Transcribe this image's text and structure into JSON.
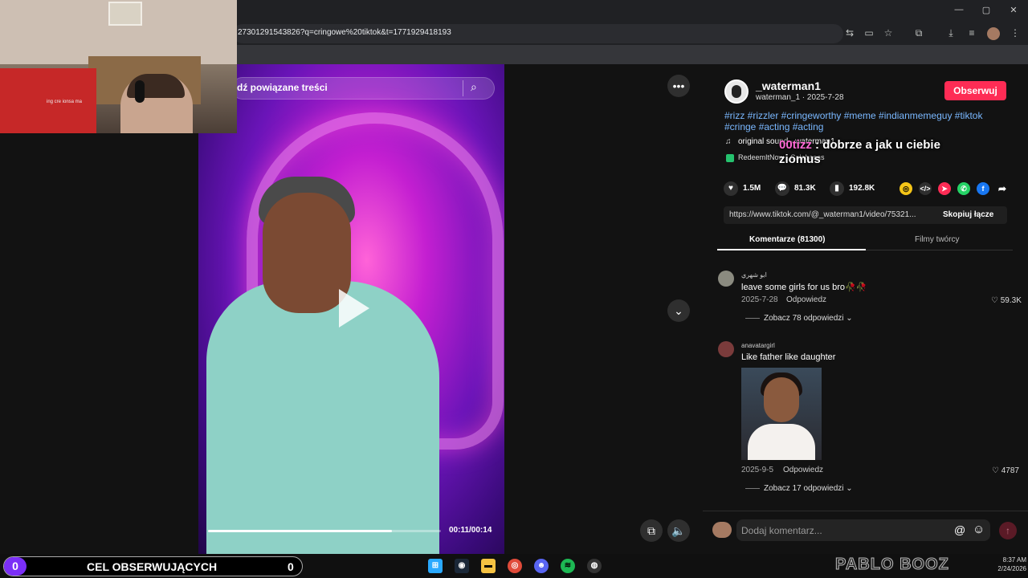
{
  "browser": {
    "url": "27301291543826?q=cringowe%20tiktok&t=1771929418193",
    "window_controls": {
      "minimize": "—",
      "maximize": "▢",
      "close": "✕"
    }
  },
  "webcam": {
    "label": "ing cre ionsa ma"
  },
  "video": {
    "search_placeholder": "dź powiązane treści",
    "time": "00:11/00:14",
    "progress": 0.79
  },
  "creator": {
    "username": "_waterman1",
    "handle_date": "waterman_1 · 2025-7-28",
    "follow_label": "Obserwuj",
    "hashtags": "#rizz #rizzler #cringeworthy #meme #indianmemeguy #tiktok #cringe #acting #acting",
    "music": "original sound - ",
    "music_tail": "waterman1",
    "redeem": "RedeemItNow · Calabasas"
  },
  "overlay": {
    "name": "00tizz",
    "message": " : dobrze a jak u ciebie",
    "message2": "ziomus"
  },
  "stats": {
    "likes": "1.5M",
    "comments": "81.3K",
    "saves": "192.8K"
  },
  "share": {
    "link": "https://www.tiktok.com/@_waterman1/video/75321...",
    "copy_label": "Skopiuj łącze"
  },
  "tabs": {
    "comments": "Komentarze (81300)",
    "creator_videos": "Filmy twórcy"
  },
  "comments": [
    {
      "user": "ابو شهري",
      "text": "leave some girls for us bro🥀🥀",
      "date": "2025-7-28",
      "reply": "Odpowiedz",
      "likes": "59.3K",
      "more": "Zobacz 78 odpowiedzi"
    },
    {
      "user": "anavatargirl",
      "text": "Like father like daughter",
      "date": "2025-9-5",
      "reply": "Odpowiedz",
      "likes": "4787",
      "more": "Zobacz 17 odpowiedzi"
    }
  ],
  "comment_input": {
    "placeholder": "Dodaj komentarz..."
  },
  "stream_goal": {
    "count": "0",
    "label": "CEL OBSERWUJĄCYCH",
    "value": "0"
  },
  "taskbar": {
    "logo_text": "PABLO BOOZ",
    "time": "8:37 AM",
    "date": "2/24/2026"
  },
  "colors": {
    "accent": "#fe2c55",
    "hashtag": "#7ab8ff",
    "goal": "#7b2ff7"
  }
}
